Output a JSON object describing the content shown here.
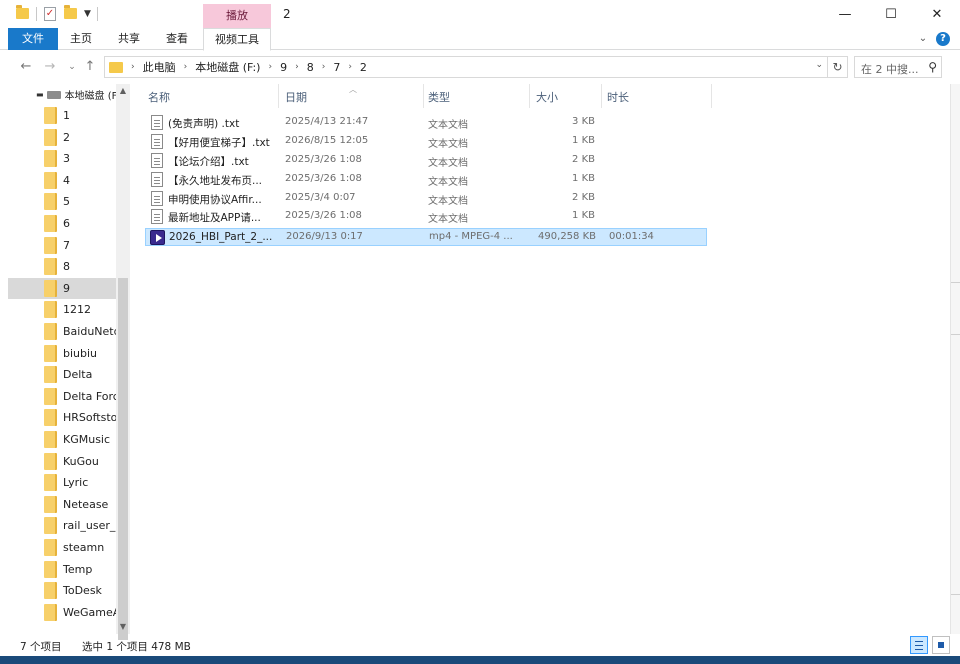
{
  "window": {
    "title": "2",
    "context_tab": "播放",
    "minimize": "—",
    "maximize": "☐",
    "close": "✕"
  },
  "ribbon": {
    "tabs": [
      "文件",
      "主页",
      "共享",
      "查看",
      "视频工具"
    ],
    "help": "?"
  },
  "address": {
    "breadcrumbs": [
      "此电脑",
      "本地磁盘 (F:)",
      "9",
      "8",
      "7",
      "2"
    ],
    "search_placeholder": "在 2 中搜..."
  },
  "nav_pane": {
    "root": "本地磁盘 (F:",
    "folders": [
      "1",
      "2",
      "3",
      "4",
      "5",
      "6",
      "7",
      "8",
      "9",
      "1212",
      "BaiduNetd",
      "biubiu",
      "Delta",
      "Delta Forc",
      "HRSoftsto",
      "KGMusic",
      "KuGou",
      "Lyric",
      "Netease",
      "rail_user_c",
      "steamn",
      "Temp",
      "ToDesk",
      "WeGameA"
    ],
    "selected": "9"
  },
  "columns": {
    "name": "名称",
    "date": "日期",
    "type": "类型",
    "size": "大小",
    "duration": "时长"
  },
  "files": [
    {
      "name": "(免责声明) .txt",
      "date": "2025/4/13 21:47",
      "type": "文本文档",
      "size": "3 KB",
      "duration": "",
      "kind": "txt"
    },
    {
      "name": "【好用便宜梯子】.txt",
      "date": "2026/8/15 12:05",
      "type": "文本文档",
      "size": "1 KB",
      "duration": "",
      "kind": "txt"
    },
    {
      "name": "【论坛介绍】.txt",
      "date": "2025/3/26 1:08",
      "type": "文本文档",
      "size": "2 KB",
      "duration": "",
      "kind": "txt"
    },
    {
      "name": "【永久地址发布页...",
      "date": "2025/3/26 1:08",
      "type": "文本文档",
      "size": "1 KB",
      "duration": "",
      "kind": "txt"
    },
    {
      "name": "申明使用协议Affir...",
      "date": "2025/3/4 0:07",
      "type": "文本文档",
      "size": "2 KB",
      "duration": "",
      "kind": "txt"
    },
    {
      "name": "最新地址及APP请...",
      "date": "2025/3/26 1:08",
      "type": "文本文档",
      "size": "1 KB",
      "duration": "",
      "kind": "txt"
    },
    {
      "name": "2026_HBI_Part_2_...",
      "date": "2026/9/13 0:17",
      "type": "mp4 - MPEG-4 ...",
      "size": "490,258 KB",
      "duration": "00:01:34",
      "kind": "video"
    }
  ],
  "status": {
    "count": "7 个项目",
    "selection": "选中 1 个项目  478 MB"
  }
}
